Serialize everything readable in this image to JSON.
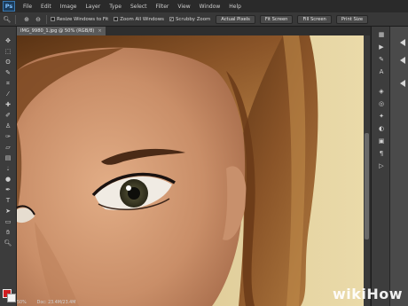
{
  "app": {
    "logo": "Ps"
  },
  "menu": [
    "File",
    "Edit",
    "Image",
    "Layer",
    "Type",
    "Select",
    "Filter",
    "View",
    "Window",
    "Help"
  ],
  "options": {
    "resize_windows": "Resize Windows to Fit",
    "zoom_all": "Zoom All Windows",
    "scrubby_zoom": "Scrubby Zoom",
    "buttons": [
      "Actual Pixels",
      "Fit Screen",
      "Fill Screen",
      "Print Size"
    ]
  },
  "document": {
    "tab_title": "IMG_9980_1.jpg @ 50% (RGB/8)",
    "close": "×"
  },
  "status": {
    "zoom": "50%",
    "doc": "Doc: 23.4M/23.4M"
  },
  "watermark": {
    "wiki": "wiki",
    "how": "How"
  },
  "icons": {
    "tools": [
      "move-icon",
      "marquee-icon",
      "lasso-icon",
      "quick-select-icon",
      "crop-icon",
      "eyedropper-icon",
      "healing-icon",
      "brush-icon",
      "clone-stamp-icon",
      "history-brush-icon",
      "eraser-icon",
      "gradient-icon",
      "blur-icon",
      "dodge-icon",
      "pen-icon",
      "type-icon",
      "path-select-icon",
      "shape-icon",
      "hand-icon",
      "zoom-icon"
    ],
    "dock": [
      "history-icon",
      "actions-icon",
      "play-icon",
      "brush-preset-icon",
      "character-icon",
      "paragraph-icon",
      "layers-icon",
      "channels-icon",
      "paths-icon",
      "adjustments-icon",
      "styles-icon"
    ]
  },
  "colors": {
    "foreground": "#d01c20",
    "background": "#f2f2f2"
  }
}
